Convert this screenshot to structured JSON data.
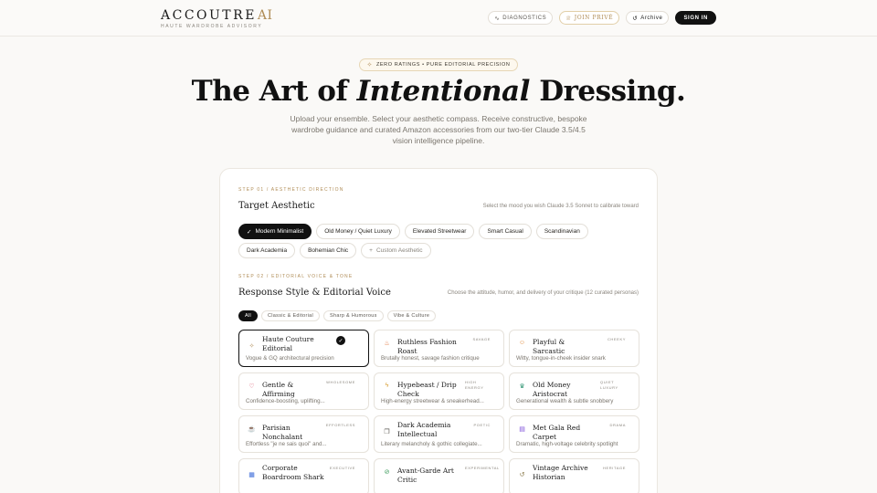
{
  "brand": {
    "name": "ACCOUTRE",
    "ai": "AI",
    "subtitle": "HAUTE WARDROBE ADVISORY"
  },
  "nav": {
    "diagnostics": "DIAGNOSTICS",
    "join_prive": "JOIN PRIVÉ",
    "archive": "Archive",
    "sign_in": "SIGN IN"
  },
  "hero": {
    "pill": "ZERO RATINGS • PURE EDITORIAL PRECISION",
    "title_a": "The Art of ",
    "title_em": "Intentional",
    "title_b": " Dressing.",
    "subtitle": "Upload your ensemble. Select your aesthetic compass. Receive constructive, bespoke wardrobe guidance and curated Amazon accessories from our two-tier Claude 3.5/4.5 vision intelligence pipeline."
  },
  "step1": {
    "label": "STEP 01 / AESTHETIC DIRECTION",
    "title": "Target Aesthetic",
    "hint": "Select the mood you wish Claude 3.5 Sonnet to calibrate toward",
    "chips": [
      {
        "label": "Modern Minimalist",
        "active": true
      },
      {
        "label": "Old Money / Quiet Luxury"
      },
      {
        "label": "Elevated Streetwear"
      },
      {
        "label": "Smart Casual"
      },
      {
        "label": "Scandinavian"
      },
      {
        "label": "Dark Academia"
      },
      {
        "label": "Bohemian Chic"
      },
      {
        "label": "Custom Aesthetic",
        "custom": true
      }
    ]
  },
  "step2": {
    "label": "STEP 02 / EDITORIAL VOICE & TONE",
    "title": "Response Style & Editorial Voice",
    "hint": "Choose the attitude, humor, and delivery of your critique (12 curated personas)",
    "tabs": [
      "All",
      "Classic & Editorial",
      "Sharp & Humorous",
      "Vibe & Culture"
    ],
    "personas": [
      {
        "name": "Haute Couture Editorial",
        "tag": "",
        "desc": "Vogue & GQ architectural precision",
        "icon": "sparkle-icon",
        "glyph": "✧",
        "color": "#b08d57",
        "selected": true
      },
      {
        "name": "Ruthless Fashion Roast",
        "tag": "SAVAGE",
        "desc": "Brutally honest, savage fashion critique",
        "icon": "flame-icon",
        "glyph": "♨",
        "color": "#e0723a"
      },
      {
        "name": "Playful & Sarcastic",
        "tag": "CHEEKY",
        "desc": "Witty, tongue-in-cheek insider snark",
        "icon": "smile-icon",
        "glyph": "☺",
        "color": "#e0893a"
      },
      {
        "name": "Gentle & Affirming",
        "tag": "WHOLESOME",
        "desc": "Confidence-boosting, uplifting...",
        "icon": "heart-icon",
        "glyph": "♡",
        "color": "#d9536b"
      },
      {
        "name": "Hypebeast / Drip Check",
        "tag": "HIGH ENERGY",
        "desc": "High-energy streetwear & sneakerhead...",
        "icon": "bolt-icon",
        "glyph": "ϟ",
        "color": "#d9a13a"
      },
      {
        "name": "Old Money Aristocrat",
        "tag": "QUIET LUXURY",
        "desc": "Generational wealth & subtle snobbery",
        "icon": "crown-icon",
        "glyph": "♛",
        "color": "#3a9a7a"
      },
      {
        "name": "Parisian Nonchalant",
        "tag": "EFFORTLESS",
        "desc": "Effortless \"je ne sais quoi\" and...",
        "icon": "coffee-icon",
        "glyph": "☕",
        "color": "#8a6ad9"
      },
      {
        "name": "Dark Academia Intellectual",
        "tag": "POETIC",
        "desc": "Literary melancholy & gothic collegiate...",
        "icon": "book-icon",
        "glyph": "❐",
        "color": "#5a5650"
      },
      {
        "name": "Met Gala Red Carpet",
        "tag": "DRAMA",
        "desc": "Dramatic, high-voltage celebrity spotlight",
        "icon": "film-icon",
        "glyph": "▤",
        "color": "#7a4ad9"
      },
      {
        "name": "Corporate Boardroom Shark",
        "tag": "EXECUTIVE",
        "desc": "",
        "icon": "building-icon",
        "glyph": "▦",
        "color": "#3a6ad9"
      },
      {
        "name": "Avant-Garde Art Critic",
        "tag": "EXPERIMENTAL",
        "desc": "",
        "icon": "compass-icon",
        "glyph": "⊘",
        "color": "#3a9a5a"
      },
      {
        "name": "Vintage Archive Historian",
        "tag": "HERITAGE",
        "desc": "",
        "icon": "history-icon",
        "glyph": "↺",
        "color": "#8a7a4a"
      }
    ]
  }
}
